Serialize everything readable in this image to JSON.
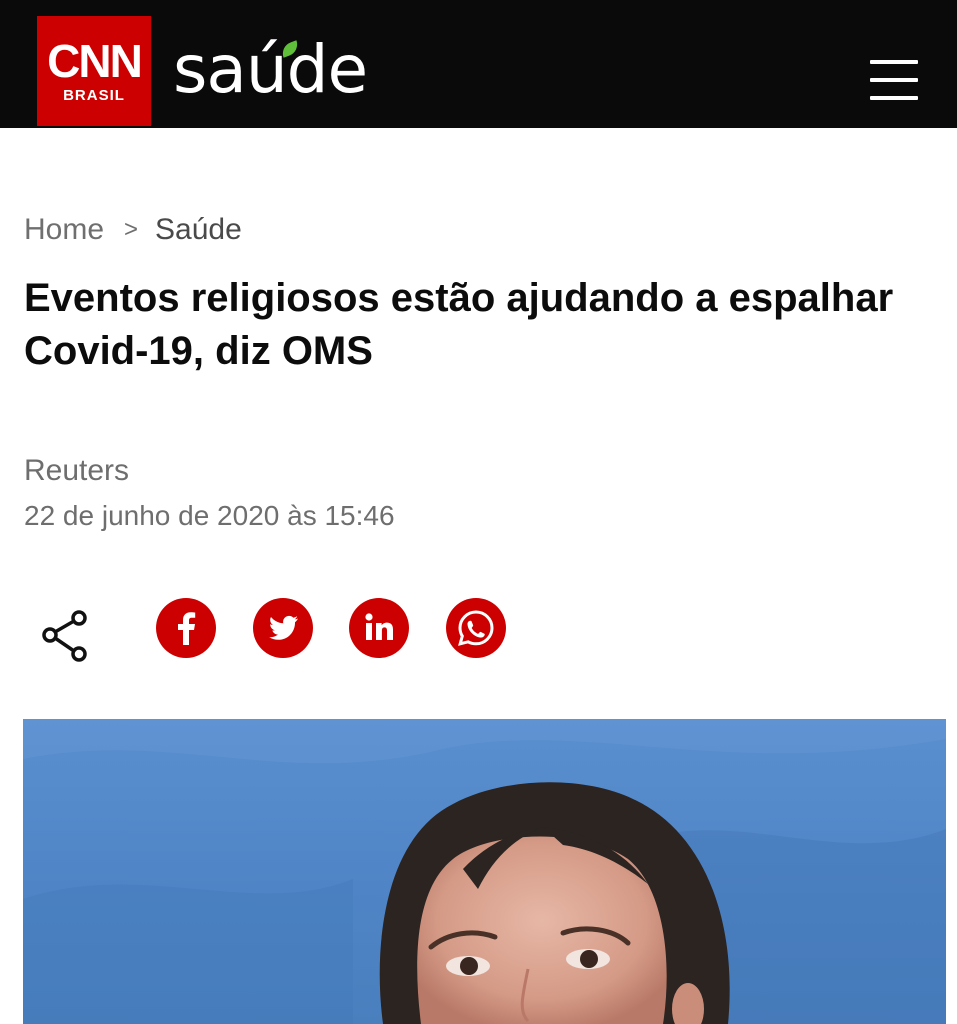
{
  "header": {
    "brand_main": "CNN",
    "brand_sub": "BRASIL",
    "section_logo": "saúde",
    "menu_icon": "hamburger-menu-icon",
    "colors": {
      "bar": "#0a0a0a",
      "brand_red": "#cc0000",
      "leaf": "#5fbf3a"
    }
  },
  "breadcrumb": {
    "home": "Home",
    "separator": ">",
    "current": "Saúde"
  },
  "article": {
    "headline": "Eventos religiosos estão ajudando a espalhar Covid-19, diz OMS",
    "source": "Reuters",
    "date": "22 de junho de 2020 às 15:46"
  },
  "share": {
    "icons": [
      "share-icon",
      "facebook-icon",
      "twitter-icon",
      "linkedin-icon",
      "whatsapp-icon"
    ],
    "color": "#cc0000"
  },
  "hero": {
    "image": "photo-of-woman-at-press-conference"
  }
}
